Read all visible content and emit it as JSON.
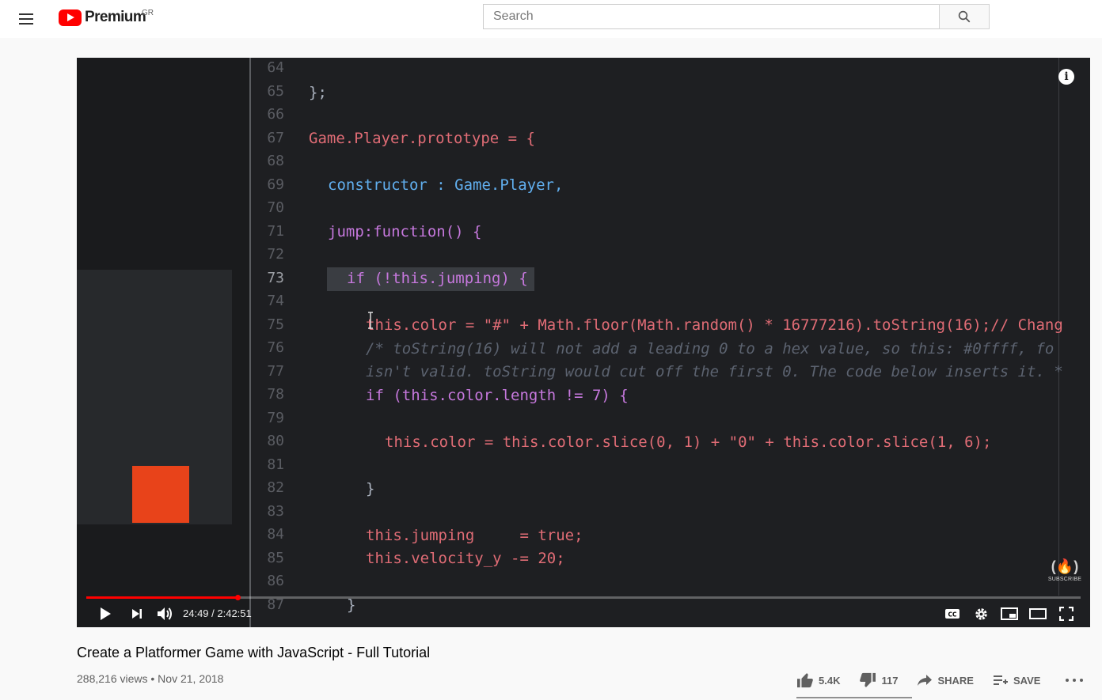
{
  "header": {
    "logo_text": "Premium",
    "country_code": "GR",
    "search_placeholder": "Search"
  },
  "player": {
    "current_time": "24:49",
    "duration": "2:42:51",
    "time_display": "24:49 / 2:42:51",
    "progress": 0.152,
    "watermark_label": "SUBSCRIBE",
    "watermark_glyph": "(🔥)",
    "gutter_lines": [
      "64",
      "65",
      "66",
      "67",
      "68",
      "69",
      "70",
      "71",
      "72",
      "73",
      "74",
      "75",
      "76",
      "77",
      "78",
      "79",
      "80",
      "81",
      "82",
      "83",
      "84",
      "85",
      "86",
      "87"
    ],
    "code": {
      "l65": "};",
      "l67": "Game.Player.prototype = {",
      "l69": "constructor : Game.Player,",
      "l71": "jump:function() {",
      "l73": "if (!this.jumping) {",
      "l75": "this.color = \"#\" + Math.floor(Math.random() * 16777216).toString(16);// Chang",
      "l76": "/* toString(16) will not add a leading 0 to a hex value, so this: #0ffff, fo",
      "l77": "isn't valid. toString would cut off the first 0. The code below inserts it. *",
      "l78": "if (this.color.length != 7) {",
      "l80": "this.color = this.color.slice(0, 1) + \"0\" + this.color.slice(1, 6);",
      "l82": "}",
      "l84": "this.jumping     = true;",
      "l85": "this.velocity_y -= 20;",
      "l87": "}"
    }
  },
  "video": {
    "title": "Create a Platformer Game with JavaScript - Full Tutorial",
    "meta": "288,216 views • Nov 21, 2018",
    "likes": "5.4K",
    "dislikes": "117",
    "share_label": "SHARE",
    "save_label": "SAVE",
    "like_ratio": 0.979
  },
  "colors": {
    "brand_red": "#ff0000",
    "orange_square": "#e8431a"
  }
}
